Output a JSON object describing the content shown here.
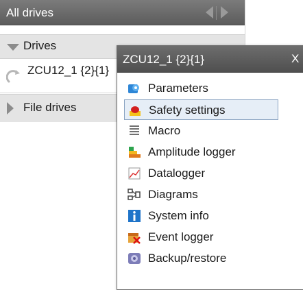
{
  "nav": {
    "title": "All drives",
    "groups": {
      "drives": "Drives",
      "file_drives": "File drives"
    },
    "drive_item": "ZCU12_1 {2}{1}"
  },
  "popup": {
    "title": "ZCU12_1 {2}{1}",
    "close": "X",
    "selected_index": 1,
    "items": [
      {
        "label": "Parameters",
        "icon": "gear-icon"
      },
      {
        "label": "Safety settings",
        "icon": "safety-button-icon"
      },
      {
        "label": "Macro",
        "icon": "macro-icon"
      },
      {
        "label": "Amplitude logger",
        "icon": "amplitude-logger-icon"
      },
      {
        "label": "Datalogger",
        "icon": "datalogger-icon"
      },
      {
        "label": "Diagrams",
        "icon": "diagram-icon"
      },
      {
        "label": "System info",
        "icon": "info-icon"
      },
      {
        "label": "Event logger",
        "icon": "event-logger-icon"
      },
      {
        "label": "Backup/restore",
        "icon": "backup-icon"
      }
    ]
  },
  "colors": {
    "header_gradient_top": "#7b7b7b",
    "header_gradient_bottom": "#5c5c5c",
    "selection_fill": "#e6eef7",
    "selection_border": "#8aa3c2"
  }
}
